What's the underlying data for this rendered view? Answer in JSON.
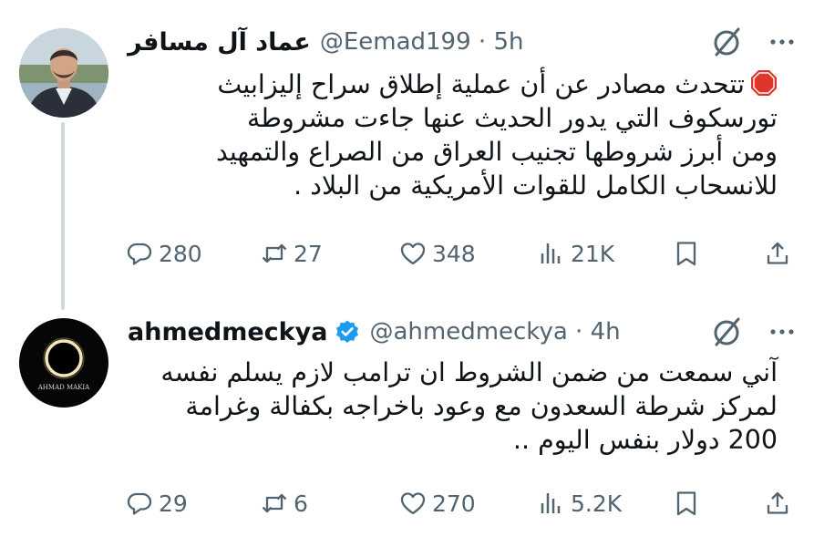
{
  "tweets": [
    {
      "display_name": "عماد آل مسافر",
      "handle": "@Eemad199",
      "time": "5h",
      "avatar_icon": "person-photo-avatar",
      "lead_icon": "stop-sign-icon",
      "lines": [
        "تتحدث مصادر عن أن عملية إطلاق سراح إليزابيث",
        "تورسكوف التي يدور الحديث عنها جاءت مشروطة",
        "ومن أبرز شروطها تجنيب العراق من الصراع والتمهيد",
        "للانسحاب الكامل للقوات الأمريكية من البلاد ."
      ],
      "stats": {
        "replies": "280",
        "reposts": "27",
        "likes": "348",
        "views": "21K"
      }
    },
    {
      "display_name": "ahmedmeckya",
      "handle": "@ahmedmeckya",
      "time": "4h",
      "verified": true,
      "avatar_icon": "eclipse-avatar",
      "avatar_text": "AHMAD MAKIA",
      "lines": [
        "آني سمعت من ضمن الشروط ان ترامب لازم يسلم نفسه",
        "لمركز شرطة السعدون مع وعود باخراجه بكفالة وغرامة",
        "200 دولار بنفس اليوم .."
      ],
      "stats": {
        "replies": "29",
        "reposts": "6",
        "likes": "270",
        "views": "5.2K"
      }
    }
  ],
  "separator": "·",
  "colors": {
    "text": "#0f1419",
    "muted": "#536471",
    "verified": "#1d9bf0",
    "thread_line": "#cfd9de"
  }
}
